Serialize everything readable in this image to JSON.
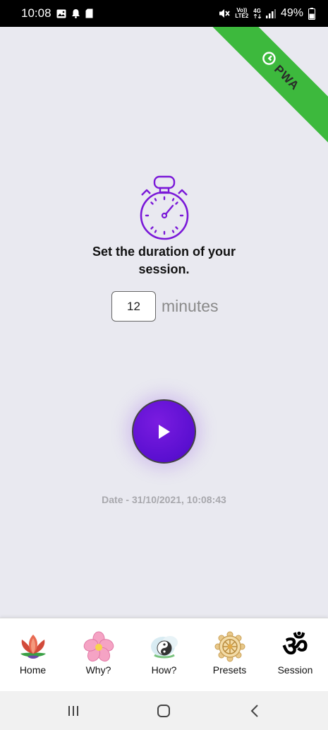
{
  "status_bar": {
    "time": "10:08",
    "network_volte": "Vo))",
    "network_lte": "LTE2",
    "network_4g": "4G",
    "battery": "49%"
  },
  "ribbon": {
    "text": "PWA"
  },
  "session": {
    "prompt_line1": "Set the duration of your",
    "prompt_line2": "session.",
    "duration_value": "12",
    "unit": "minutes",
    "date": "Date - 31/10/2021, 10:08:43"
  },
  "colors": {
    "accent": "#6a12d8",
    "ribbon": "#3db93d",
    "background": "#e9e9f0"
  },
  "bottom_nav": {
    "items": [
      {
        "label": "Home",
        "icon": "lotus-icon"
      },
      {
        "label": "Why?",
        "icon": "flower-icon"
      },
      {
        "label": "How?",
        "icon": "yin-yang-icon"
      },
      {
        "label": "Presets",
        "icon": "dharma-wheel-icon"
      },
      {
        "label": "Session",
        "icon": "om-icon",
        "glyph": "ॐ"
      }
    ]
  }
}
